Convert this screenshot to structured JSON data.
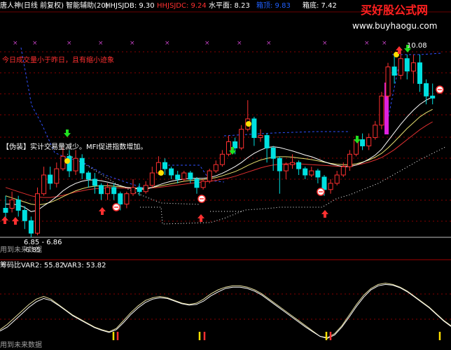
{
  "header": {
    "stock_name": "唐人神(日线 前复权) 智能辅助(20)",
    "indicators": [
      {
        "label": "HHJSJDB: 9.30",
        "color": "#ffffff"
      },
      {
        "label": "HHJSJDC: 9.24",
        "color": "#ff3030"
      },
      {
        "label": "水平面: 8.23",
        "color": "#ffffff"
      },
      {
        "label": "箱顶: 9.83",
        "color": "#2060ff"
      },
      {
        "label": "箱底: 7.42",
        "color": "#ffffff"
      }
    ]
  },
  "watermark": {
    "brand": "买好股公式网",
    "url": "www.buyhaogu.com"
  },
  "annotations": {
    "signal_red": "今日成交量小于昨日，且有缩小迹象",
    "signal_yellow": "【伪装】实计交易量减少。MFI促进指数增加。",
    "price_high": "10.08",
    "price_range": "6.85 - 6.86",
    "price_low": "6.85",
    "bottom_note_main": "用到未来数据",
    "bottom_note_sub": "用到未来数据"
  },
  "sub_panel": {
    "title": "筹码比",
    "values": [
      "VAR2: 55.82",
      "VAR3: 53.82"
    ]
  },
  "colors": {
    "up": "#ff3030",
    "down": "#00e0e0",
    "ma_white": "#ffffff",
    "ma_yellow": "#e8e070",
    "ma_red": "#e03030",
    "dots": "#ffffff",
    "blue_box": "#3050ff",
    "magenta": "#e020e0",
    "grid": "#8a0000"
  },
  "chart_data": {
    "type": "candlestick",
    "price_axis_visible": false,
    "candles": [
      [
        6.6,
        6.5,
        6.9,
        6.35
      ],
      [
        6.6,
        6.8,
        7.0,
        6.5
      ],
      [
        6.8,
        6.55,
        6.9,
        6.4
      ],
      [
        6.55,
        6.3,
        6.65,
        6.1
      ],
      [
        6.3,
        6.0,
        6.4,
        5.9
      ],
      [
        6.0,
        6.95,
        7.1,
        5.95
      ],
      [
        6.95,
        7.4,
        7.6,
        6.9
      ],
      [
        7.4,
        7.2,
        7.6,
        7.05
      ],
      [
        7.2,
        7.55,
        7.7,
        7.1
      ],
      [
        7.55,
        7.85,
        8.05,
        7.5
      ],
      [
        7.85,
        7.5,
        8.0,
        7.35
      ],
      [
        7.5,
        7.8,
        8.0,
        7.4
      ],
      [
        7.8,
        7.45,
        7.9,
        7.3
      ],
      [
        7.45,
        7.3,
        7.5,
        7.1
      ],
      [
        7.3,
        7.15,
        7.45,
        6.95
      ],
      [
        7.15,
        6.95,
        7.2,
        6.8
      ],
      [
        6.95,
        7.1,
        7.2,
        6.8
      ],
      [
        7.1,
        6.95,
        7.2,
        6.8
      ],
      [
        6.95,
        6.7,
        7.0,
        6.55
      ],
      [
        6.7,
        6.95,
        7.0,
        6.6
      ],
      [
        6.95,
        7.1,
        7.3,
        6.9
      ],
      [
        7.1,
        7.0,
        7.2,
        6.9
      ],
      [
        7.0,
        7.15,
        7.25,
        6.95
      ],
      [
        7.15,
        7.45,
        7.6,
        7.1
      ],
      [
        7.45,
        7.7,
        7.85,
        7.4
      ],
      [
        7.7,
        7.55,
        7.8,
        7.4
      ],
      [
        7.55,
        7.4,
        7.6,
        7.3
      ],
      [
        7.4,
        7.3,
        7.5,
        7.2
      ],
      [
        7.3,
        7.45,
        7.5,
        7.25
      ],
      [
        7.45,
        7.3,
        7.5,
        7.2
      ],
      [
        7.3,
        7.1,
        7.35,
        6.95
      ],
      [
        7.1,
        7.25,
        7.3,
        7.05
      ],
      [
        7.25,
        7.5,
        7.55,
        7.2
      ],
      [
        7.5,
        7.65,
        7.75,
        7.45
      ],
      [
        7.65,
        7.9,
        8.0,
        7.6
      ],
      [
        7.9,
        8.2,
        8.35,
        7.85
      ],
      [
        8.2,
        8.05,
        8.3,
        7.9
      ],
      [
        8.05,
        8.5,
        8.6,
        8.0
      ],
      [
        8.5,
        8.75,
        9.2,
        8.45
      ],
      [
        8.75,
        8.3,
        8.8,
        8.1
      ],
      [
        8.3,
        8.35,
        8.5,
        8.2
      ],
      [
        8.35,
        8.05,
        8.4,
        7.7
      ],
      [
        8.05,
        7.8,
        8.1,
        7.5
      ],
      [
        7.8,
        7.5,
        7.85,
        6.95
      ],
      [
        7.5,
        7.65,
        7.7,
        7.3
      ],
      [
        7.65,
        7.7,
        7.9,
        7.55
      ],
      [
        7.7,
        7.55,
        7.75,
        7.4
      ],
      [
        7.55,
        7.4,
        7.6,
        7.3
      ],
      [
        7.4,
        7.5,
        7.6,
        7.35
      ],
      [
        7.5,
        7.35,
        7.55,
        7.2
      ],
      [
        7.35,
        7.05,
        7.4,
        6.9
      ],
      [
        7.05,
        7.2,
        7.3,
        6.95
      ],
      [
        7.2,
        7.4,
        7.5,
        7.15
      ],
      [
        7.4,
        7.6,
        7.7,
        7.35
      ],
      [
        7.6,
        7.9,
        8.0,
        7.5
      ],
      [
        7.9,
        8.25,
        8.35,
        7.85
      ],
      [
        8.25,
        8.1,
        8.4,
        8.0
      ],
      [
        8.1,
        8.3,
        8.4,
        8.0
      ],
      [
        8.3,
        8.6,
        8.7,
        8.25
      ],
      [
        8.6,
        9.3,
        9.4,
        8.5
      ],
      [
        9.3,
        10.0,
        10.1,
        9.2
      ],
      [
        10.0,
        9.8,
        10.3,
        9.6
      ],
      [
        9.8,
        10.2,
        10.4,
        9.7
      ],
      [
        10.2,
        9.9,
        10.3,
        9.7
      ],
      [
        9.9,
        10.1,
        10.3,
        9.6
      ],
      [
        10.1,
        9.6,
        10.3,
        9.4
      ],
      [
        9.6,
        9.3,
        9.7,
        9.1
      ],
      [
        9.3,
        9.25,
        9.6,
        9.1
      ]
    ],
    "ma_white": [
      6.7,
      6.7,
      6.68,
      6.62,
      6.52,
      6.55,
      6.66,
      6.76,
      6.88,
      7.02,
      7.12,
      7.2,
      7.25,
      7.28,
      7.28,
      7.26,
      7.23,
      7.19,
      7.14,
      7.1,
      7.08,
      7.06,
      7.06,
      7.1,
      7.16,
      7.21,
      7.25,
      7.28,
      7.3,
      7.32,
      7.32,
      7.32,
      7.34,
      7.38,
      7.44,
      7.52,
      7.6,
      7.7,
      7.82,
      7.92,
      8.0,
      8.06,
      8.08,
      8.06,
      8.02,
      7.98,
      7.93,
      7.88,
      7.84,
      7.78,
      7.72,
      7.67,
      7.63,
      7.6,
      7.6,
      7.64,
      7.7,
      7.78,
      7.88,
      8.02,
      8.22,
      8.42,
      8.62,
      8.8,
      8.96,
      9.1,
      9.2,
      9.28
    ],
    "ma_yellow": [
      6.9,
      6.85,
      6.8,
      6.75,
      6.7,
      6.68,
      6.7,
      6.74,
      6.8,
      6.88,
      6.95,
      7.02,
      7.07,
      7.11,
      7.13,
      7.14,
      7.14,
      7.13,
      7.12,
      7.1,
      7.09,
      7.08,
      7.08,
      7.1,
      7.13,
      7.16,
      7.19,
      7.22,
      7.25,
      7.27,
      7.28,
      7.29,
      7.31,
      7.34,
      7.38,
      7.43,
      7.48,
      7.55,
      7.63,
      7.7,
      7.76,
      7.8,
      7.83,
      7.84,
      7.84,
      7.83,
      7.81,
      7.79,
      7.77,
      7.74,
      7.71,
      7.68,
      7.66,
      7.65,
      7.65,
      7.67,
      7.71,
      7.76,
      7.83,
      7.92,
      8.05,
      8.2,
      8.36,
      8.52,
      8.66,
      8.8,
      8.9,
      8.98
    ],
    "ma_red": [
      7.1,
      7.05,
      7.0,
      6.95,
      6.9,
      6.87,
      6.86,
      6.86,
      6.88,
      6.91,
      6.95,
      6.99,
      7.02,
      7.05,
      7.07,
      7.08,
      7.09,
      7.09,
      7.09,
      7.08,
      7.08,
      7.08,
      7.08,
      7.09,
      7.1,
      7.12,
      7.14,
      7.16,
      7.18,
      7.2,
      7.22,
      7.23,
      7.25,
      7.27,
      7.3,
      7.33,
      7.37,
      7.42,
      7.47,
      7.52,
      7.57,
      7.61,
      7.64,
      7.66,
      7.67,
      7.67,
      7.67,
      7.66,
      7.65,
      7.64,
      7.63,
      7.62,
      7.61,
      7.61,
      7.62,
      7.64,
      7.67,
      7.71,
      7.76,
      7.82,
      7.91,
      8.01,
      8.13,
      8.25,
      8.37,
      8.49,
      8.59,
      8.68
    ],
    "var2": [
      20,
      28,
      38,
      48,
      58,
      66,
      70,
      66,
      58,
      50,
      42,
      36,
      30,
      24,
      20,
      17,
      22,
      34,
      46,
      56,
      64,
      68,
      70,
      68,
      64,
      60,
      58,
      60,
      66,
      74,
      80,
      84,
      86,
      86,
      84,
      80,
      74,
      66,
      58,
      50,
      42,
      34,
      26,
      18,
      10,
      8,
      14,
      26,
      42,
      58,
      72,
      82,
      88,
      90,
      88,
      84,
      78,
      70,
      62,
      54,
      44,
      34,
      26
    ],
    "var3": [
      18,
      24,
      34,
      44,
      54,
      62,
      67,
      64,
      57,
      49,
      41,
      35,
      29,
      23,
      19,
      16,
      20,
      31,
      43,
      53,
      61,
      66,
      68,
      67,
      63,
      59,
      57,
      58,
      63,
      71,
      77,
      82,
      84,
      84,
      82,
      78,
      72,
      64,
      56,
      48,
      40,
      32,
      24,
      17,
      10,
      7,
      12,
      24,
      39,
      55,
      69,
      80,
      86,
      88,
      87,
      83,
      77,
      69,
      61,
      53,
      43,
      33,
      25
    ],
    "var_range": [
      0,
      100
    ],
    "var3_color": "#ffffff",
    "var2_color": "#e8e0a0"
  }
}
